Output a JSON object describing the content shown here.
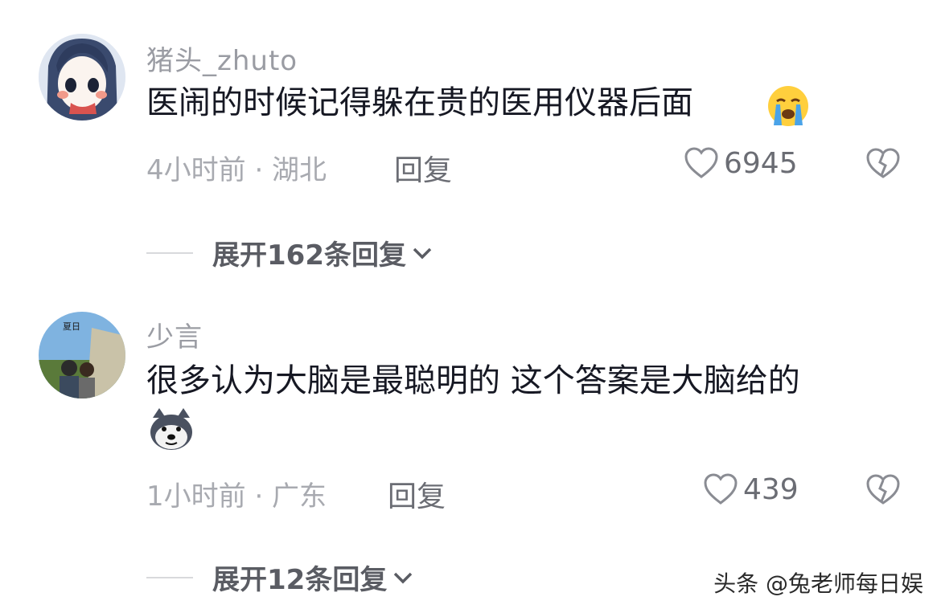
{
  "comments": [
    {
      "username": "猪头_zhuto",
      "text": "医闹的时候记得躲在贵的医用仪器后面",
      "emoji": "crying-face-emoji",
      "meta": "4小时前 · 湖北",
      "reply_label": "回复",
      "likes": "6945",
      "expand_label": "展开162条回复"
    },
    {
      "username": "少言",
      "text": "很多认为大脑是最聪明的  这个答案是大脑给的",
      "emoji": "doge-emoji",
      "meta": "1小时前 · 广东",
      "reply_label": "回复",
      "likes": "439",
      "expand_label": "展开12条回复"
    }
  ],
  "avatar1_text": "",
  "avatar2_text": "夏日",
  "watermark": "头条 @兔老师每日娱",
  "colors": {
    "secondary_text": "#9a9ca3",
    "primary_text": "#161823"
  }
}
